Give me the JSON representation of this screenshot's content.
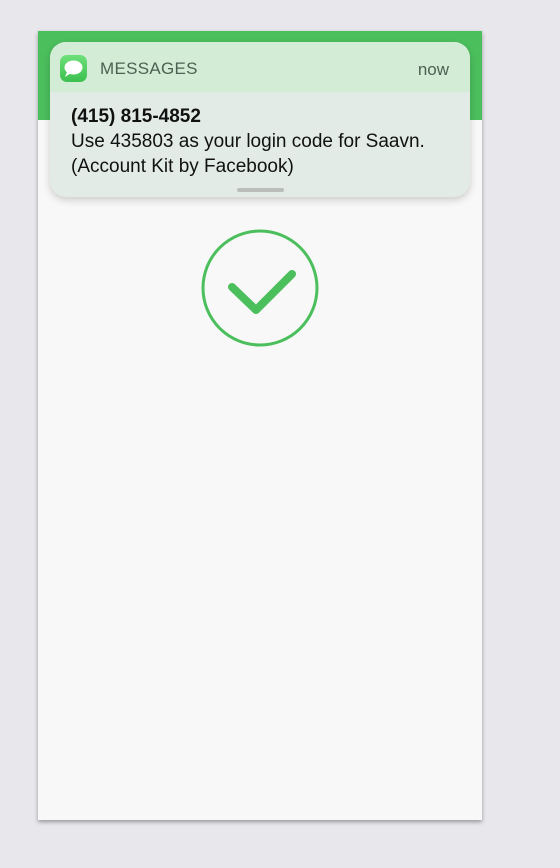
{
  "notification": {
    "app_name": "MESSAGES",
    "time": "now",
    "sender": "(415) 815-4852",
    "message": "Use 435803 as your login code for Saavn. (Account Kit by Facebook)",
    "app_icon": "messages-icon"
  },
  "main": {
    "status_icon": "checkmark-circle-icon"
  },
  "colors": {
    "accent": "#4cbf5d"
  }
}
